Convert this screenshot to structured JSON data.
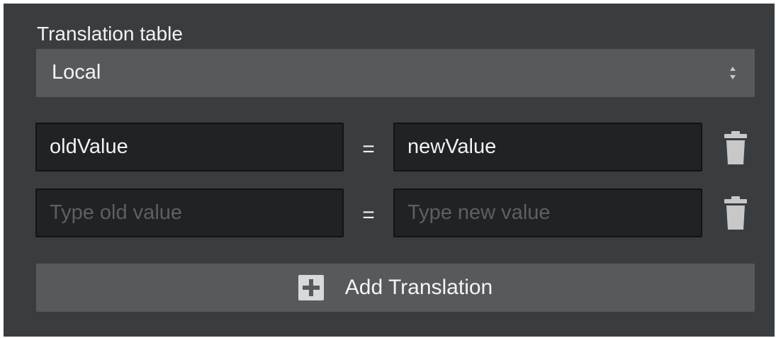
{
  "section": {
    "title": "Translation table"
  },
  "select": {
    "value": "Local",
    "icon": "sort-arrows-icon"
  },
  "rows": [
    {
      "old_value": "oldValue",
      "old_placeholder": "",
      "separator": "=",
      "new_value": "newValue",
      "new_placeholder": "",
      "icon": "trash-icon"
    },
    {
      "old_value": "",
      "old_placeholder": "Type old value",
      "separator": "=",
      "new_value": "",
      "new_placeholder": "Type new value",
      "icon": "trash-icon"
    }
  ],
  "add_button": {
    "label": "Add Translation",
    "icon": "plus-icon"
  },
  "colors": {
    "panel_bg": "#3a3d40",
    "control_bg": "#575a5c",
    "input_bg": "#202224",
    "text": "#f2f2f2",
    "placeholder": "#5c6064",
    "icon": "#c8c8c8"
  }
}
